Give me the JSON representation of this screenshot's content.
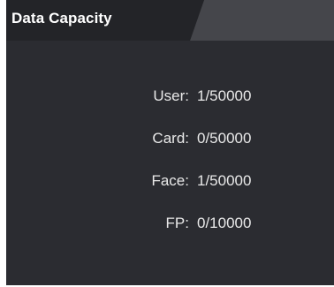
{
  "panel": {
    "title": "Data Capacity",
    "colors": {
      "background": "#2b2c31",
      "header_tab": "#232428",
      "header_strip": "#45464b",
      "text": "#e9e9e9"
    }
  },
  "capacity": {
    "rows": [
      {
        "label": "User:",
        "value": "1/50000"
      },
      {
        "label": "Card:",
        "value": "0/50000"
      },
      {
        "label": "Face:",
        "value": "1/50000"
      },
      {
        "label": "FP:",
        "value": "0/10000"
      }
    ]
  }
}
